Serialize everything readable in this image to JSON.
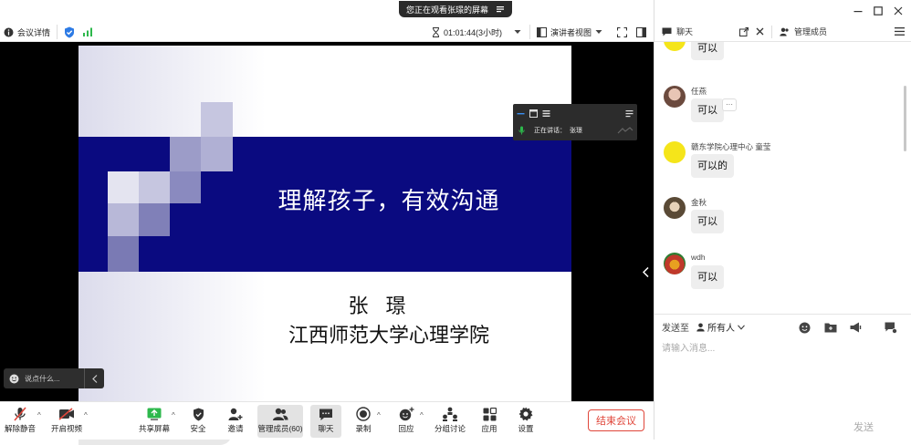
{
  "share_tip": {
    "text": "您正在观看张璟的屏幕"
  },
  "info_bar": {
    "meeting_details": "会议详情",
    "duration": "01:01:44(3小时)",
    "view_mode": "演讲者视图"
  },
  "slide": {
    "title": "理解孩子，有效沟通",
    "presenter": "张 璟",
    "institution": "江西师范大学心理学院"
  },
  "speaker_panel": {
    "speaking_label": "正在讲话：",
    "speaker": "张璟"
  },
  "say_box": {
    "placeholder": "说点什么..."
  },
  "toolbar": {
    "unmute": "解除静音",
    "start_video": "开启视频",
    "share_screen": "共享屏幕",
    "security": "安全",
    "invite": "邀请",
    "manage_members": "管理成员(60)",
    "chat": "聊天",
    "record": "录制",
    "reactions": "回应",
    "breakout": "分组讨论",
    "apps": "应用",
    "settings": "设置",
    "end_meeting": "结束会议"
  },
  "chat": {
    "title": "聊天",
    "manage_members": "管理成员",
    "messages": [
      {
        "name": "",
        "text": "可以",
        "avatar_color": "#f5e51a"
      },
      {
        "name": "任燕",
        "text": "可以",
        "avatar_color": "#b58a7a"
      },
      {
        "name": "赣东学院心理中心 童莹",
        "text": "可以的",
        "avatar_color": "#f5e51a"
      },
      {
        "name": "金秋",
        "text": "可以",
        "avatar_color": "#8c7b5e"
      },
      {
        "name": "wdh",
        "text": "可以",
        "avatar_color": "#c0392b"
      }
    ],
    "more_label": "···",
    "send_to_label": "发送至",
    "recipient": "所有人",
    "input_placeholder": "请输入消息...",
    "send_label": "发送"
  },
  "colors": {
    "slide_band": "#0a0a80",
    "end_button": "#e0463a",
    "signal": "#2db84c"
  }
}
